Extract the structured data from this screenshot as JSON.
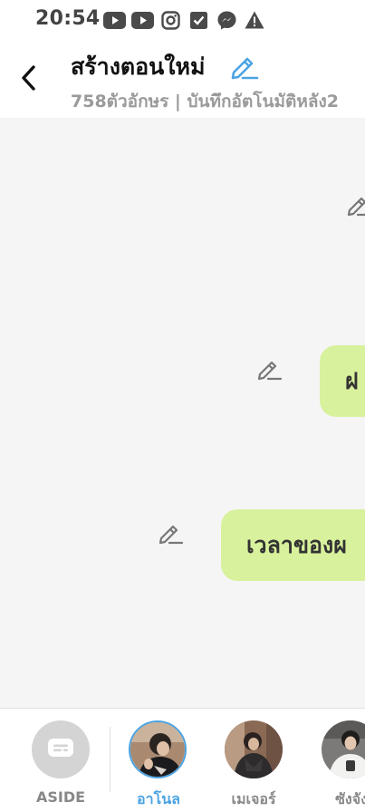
{
  "status_bar": {
    "time": "20:54",
    "icons": [
      "youtube-icon",
      "youtube-icon",
      "instagram-icon",
      "check-square-icon",
      "messenger-icon",
      "warning-icon"
    ]
  },
  "header": {
    "title": "สร้างตอนใหม่",
    "subtitle": "758ตัวอักษร | บันทึกอัตโนมัติหลัง2",
    "accent_color": "#4ba3e3"
  },
  "chat": {
    "bubble_color": "#d8f19c",
    "messages": [
      {
        "text": "ฝ"
      },
      {
        "text": "เวลาของผ"
      }
    ]
  },
  "cast_bar": {
    "aside_label": "ASIDE",
    "characters": [
      {
        "name": "อาโนล",
        "selected": true
      },
      {
        "name": "เมเจอร์",
        "selected": false
      },
      {
        "name": "ซังจัง",
        "selected": false
      }
    ]
  }
}
